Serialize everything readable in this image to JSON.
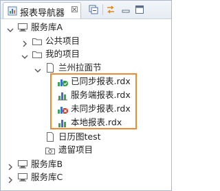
{
  "view": {
    "tab_title": "报表导航器",
    "tab_close": "☒"
  },
  "tree": {
    "server_a": "服务库A",
    "public_projects": "公共项目",
    "my_projects": "我的项目",
    "folder": "兰州拉面节",
    "files": [
      {
        "label": "已同步报表.rdx",
        "status": "synced"
      },
      {
        "label": "服务端报表.rdx",
        "status": "server"
      },
      {
        "label": "未同步报表.rdx",
        "status": "unsynced"
      },
      {
        "label": "本地报表.rdx",
        "status": "local"
      }
    ],
    "calendar": "日历图test",
    "legacy": "遗留项目",
    "server_b": "服务库B",
    "server_c": "服务库C"
  },
  "colors": {
    "highlight": "#f08a2c",
    "bar_green": "#3aa655",
    "bar_blue": "#3b6fd4"
  }
}
